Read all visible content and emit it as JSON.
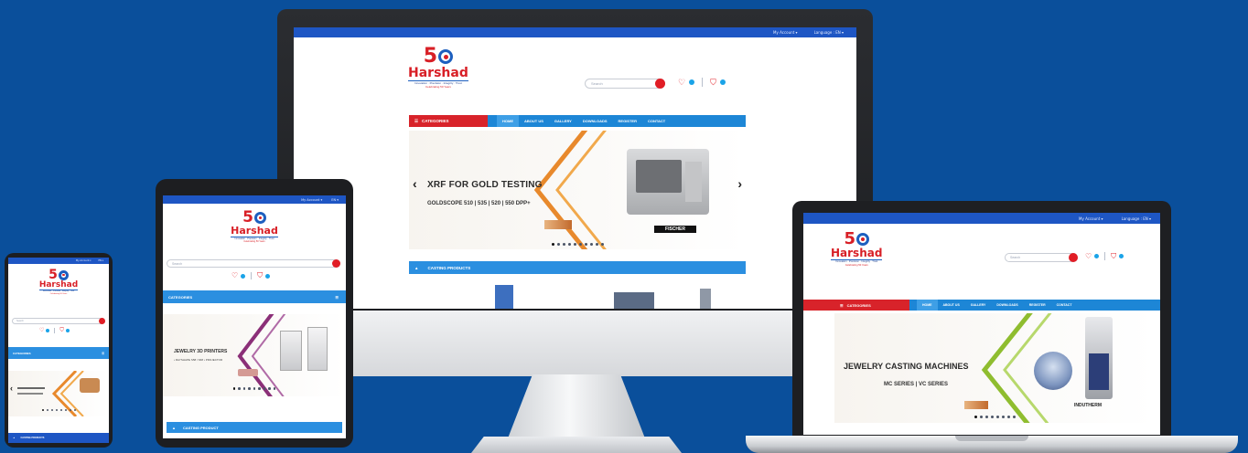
{
  "monitor": {
    "top_links": [
      "My Account ▾",
      "Language : EN ▾"
    ],
    "logo": {
      "fifty": "5",
      "name": "Harshad",
      "tagline": "Innovation · Precision · Integrity · Trust",
      "subline": "Celebrating 50 Years"
    },
    "search_placeholder": "Search",
    "categories_label": "CATEGORIES",
    "nav_items": [
      "HOME",
      "ABOUT US",
      "GALLERY",
      "DOWNLOADS",
      "REGISTER",
      "CONTACT"
    ],
    "banner": {
      "title": "XRF FOR GOLD TESTING",
      "subtitle": "GOLDSCOPE 510 | 535 | 520 | 550 DPP+",
      "brand": "FISCHER"
    },
    "section_title": "CASTING PRODUCTS"
  },
  "tablet": {
    "top_links": [
      "My Account ▾",
      "EN ▾"
    ],
    "search_placeholder": "Search",
    "categories_label": "CATEGORIES",
    "banner": {
      "title": "JEWELRY 3D PRINTERS",
      "subtitle": "• RAYSHAPE S58 / S68 • PROJECTOR"
    },
    "section_title": "CASTING PRODUCT"
  },
  "phone": {
    "top_links": [
      "My Account ▾",
      "EN ▾"
    ],
    "search_placeholder": "Search",
    "categories_label": "CATEGORIES",
    "section_title": "CASTING PRODUCTS"
  },
  "laptop": {
    "top_links": [
      "My Account ▾",
      "Language : EN ▾"
    ],
    "search_placeholder": "Search",
    "categories_label": "CATEGORIES",
    "nav_items": [
      "HOME",
      "ABOUT US",
      "GALLERY",
      "DOWNLOADS",
      "REGISTER",
      "CONTACT"
    ],
    "banner": {
      "title": "JEWELRY CASTING MACHINES",
      "subtitle": "MC SERIES | VC SERIES",
      "brand": "INDUTHERM"
    }
  },
  "colors": {
    "background": "#0a4f9b",
    "brand_red": "#d8232a",
    "nav_blue": "#1d86d6",
    "top_strip": "#1e56c4"
  }
}
